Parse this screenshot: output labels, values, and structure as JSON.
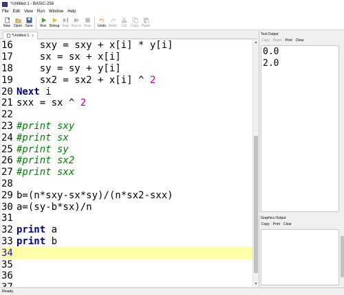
{
  "window": {
    "title": "*Untitled 1 - BASIC-256"
  },
  "menu": [
    "File",
    "Edit",
    "View",
    "Run",
    "Window",
    "Help"
  ],
  "toolbar": [
    {
      "label": "New",
      "icon": "new-file-icon",
      "enabled": true
    },
    {
      "label": "Open",
      "icon": "open-folder-icon",
      "enabled": true
    },
    {
      "label": "Save",
      "icon": "save-icon",
      "enabled": true
    },
    {
      "label": "Run",
      "icon": "run-icon",
      "enabled": true
    },
    {
      "label": "Debug",
      "icon": "debug-icon",
      "enabled": true
    },
    {
      "label": "Step",
      "icon": "step-icon",
      "enabled": false
    },
    {
      "label": "Run to",
      "icon": "run-to-icon",
      "enabled": false
    },
    {
      "label": "Stop",
      "icon": "stop-icon",
      "enabled": false
    },
    {
      "label": "Undo",
      "icon": "undo-icon",
      "enabled": true
    },
    {
      "label": "Redo",
      "icon": "redo-icon",
      "enabled": false
    },
    {
      "label": "Cut",
      "icon": "cut-icon",
      "enabled": false
    },
    {
      "label": "Copy",
      "icon": "copy-icon",
      "enabled": false
    },
    {
      "label": "Paste",
      "icon": "paste-icon",
      "enabled": false
    }
  ],
  "tab": {
    "label": "*Untitled 1",
    "close": "x"
  },
  "editor": {
    "lines": [
      {
        "num": "16",
        "segments": [
          {
            "t": "    sxy = sxy + x[i] * y[i]",
            "c": "code"
          }
        ]
      },
      {
        "num": "17",
        "segments": [
          {
            "t": "    sx = sx + x[i]",
            "c": "code"
          }
        ]
      },
      {
        "num": "18",
        "segments": [
          {
            "t": "    sy = sy + y[i]",
            "c": "code"
          }
        ]
      },
      {
        "num": "19",
        "segments": [
          {
            "t": "    sx2 = sx2 + x[i] ^ ",
            "c": "code"
          },
          {
            "t": "2",
            "c": "num"
          }
        ]
      },
      {
        "num": "20",
        "segments": [
          {
            "t": "Next",
            "c": "kw"
          },
          {
            "t": " i",
            "c": "code"
          }
        ]
      },
      {
        "num": "21",
        "segments": [
          {
            "t": "sxx = sx ^ ",
            "c": "code"
          },
          {
            "t": "2",
            "c": "num"
          }
        ]
      },
      {
        "num": "22",
        "segments": []
      },
      {
        "num": "23",
        "segments": [
          {
            "t": "#print sxy",
            "c": "cm"
          }
        ]
      },
      {
        "num": "24",
        "segments": [
          {
            "t": "#print sx",
            "c": "cm"
          }
        ]
      },
      {
        "num": "25",
        "segments": [
          {
            "t": "#print sy",
            "c": "cm"
          }
        ]
      },
      {
        "num": "26",
        "segments": [
          {
            "t": "#print sx2",
            "c": "cm"
          }
        ]
      },
      {
        "num": "27",
        "segments": [
          {
            "t": "#print sxx",
            "c": "cm"
          }
        ]
      },
      {
        "num": "28",
        "segments": []
      },
      {
        "num": "29",
        "segments": [
          {
            "t": "b=(n*sxy-sx*sy)/(n*sx2-sxx)",
            "c": "code"
          }
        ]
      },
      {
        "num": "30",
        "segments": [
          {
            "t": "a=(sy-b*sx)/n",
            "c": "code"
          }
        ]
      },
      {
        "num": "31",
        "segments": []
      },
      {
        "num": "32",
        "segments": [
          {
            "t": "print",
            "c": "kw"
          },
          {
            "t": " a",
            "c": "code"
          }
        ]
      },
      {
        "num": "33",
        "segments": [
          {
            "t": "print",
            "c": "kw"
          },
          {
            "t": " b",
            "c": "code"
          }
        ]
      },
      {
        "num": "34",
        "segments": [],
        "current": true
      },
      {
        "num": "35",
        "segments": []
      },
      {
        "num": "36",
        "segments": []
      },
      {
        "num": "37",
        "segments": []
      }
    ]
  },
  "text_output": {
    "title": "Text Output",
    "buttons": [
      {
        "label": "Copy",
        "enabled": false
      },
      {
        "label": "Paste",
        "enabled": false
      },
      {
        "label": "Print",
        "enabled": true
      },
      {
        "label": "Clear",
        "enabled": true
      }
    ],
    "lines": [
      "0.0",
      "2.0"
    ]
  },
  "graphics_output": {
    "title": "Graphics Output",
    "buttons": [
      {
        "label": "Copy",
        "enabled": true
      },
      {
        "label": "Print",
        "enabled": true
      },
      {
        "label": "Clear",
        "enabled": true
      }
    ]
  },
  "status": {
    "text": "Ready."
  },
  "colors": {
    "keyword": "#00007f",
    "comment": "#008000",
    "number": "#b00090",
    "current_line": "#ffffa8"
  }
}
